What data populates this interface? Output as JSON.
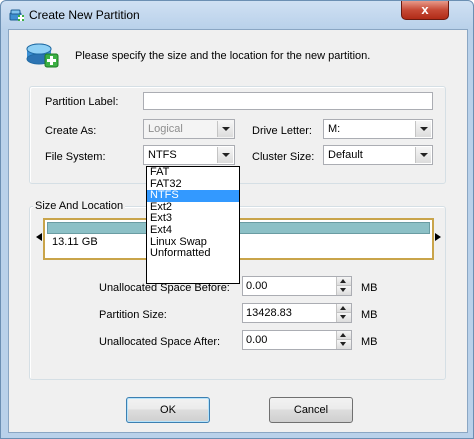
{
  "window": {
    "title": "Create New Partition",
    "close_glyph": "x"
  },
  "header": {
    "text": "Please specify the size and the location for the new partition."
  },
  "form": {
    "partition_label": {
      "label": "Partition Label:",
      "value": ""
    },
    "create_as": {
      "label": "Create As:",
      "value": "Logical"
    },
    "drive_letter": {
      "label": "Drive Letter:",
      "value": "M:"
    },
    "file_system": {
      "label": "File System:",
      "value": "NTFS"
    },
    "cluster_size": {
      "label": "Cluster Size:",
      "value": "Default"
    }
  },
  "file_system_options": [
    "FAT",
    "FAT32",
    "NTFS",
    "Ext2",
    "Ext3",
    "Ext4",
    "Linux Swap",
    "Unformatted"
  ],
  "file_system_selected_index": 2,
  "size_location": {
    "title": "Size And Location",
    "disk_size": "13.11 GB",
    "unallocated_before": {
      "label": "Unallocated Space Before:",
      "value": "0.00",
      "unit": "MB"
    },
    "partition_size": {
      "label": "Partition Size:",
      "value": "13428.83",
      "unit": "MB"
    },
    "unallocated_after": {
      "label": "Unallocated Space After:",
      "value": "0.00",
      "unit": "MB"
    }
  },
  "buttons": {
    "ok": "OK",
    "cancel": "Cancel"
  },
  "colors": {
    "title_gradient": "#b9d1ea",
    "disk_used": "#8cc0c6",
    "disk_border": "#c9a44a",
    "selection": "#3399ff"
  }
}
